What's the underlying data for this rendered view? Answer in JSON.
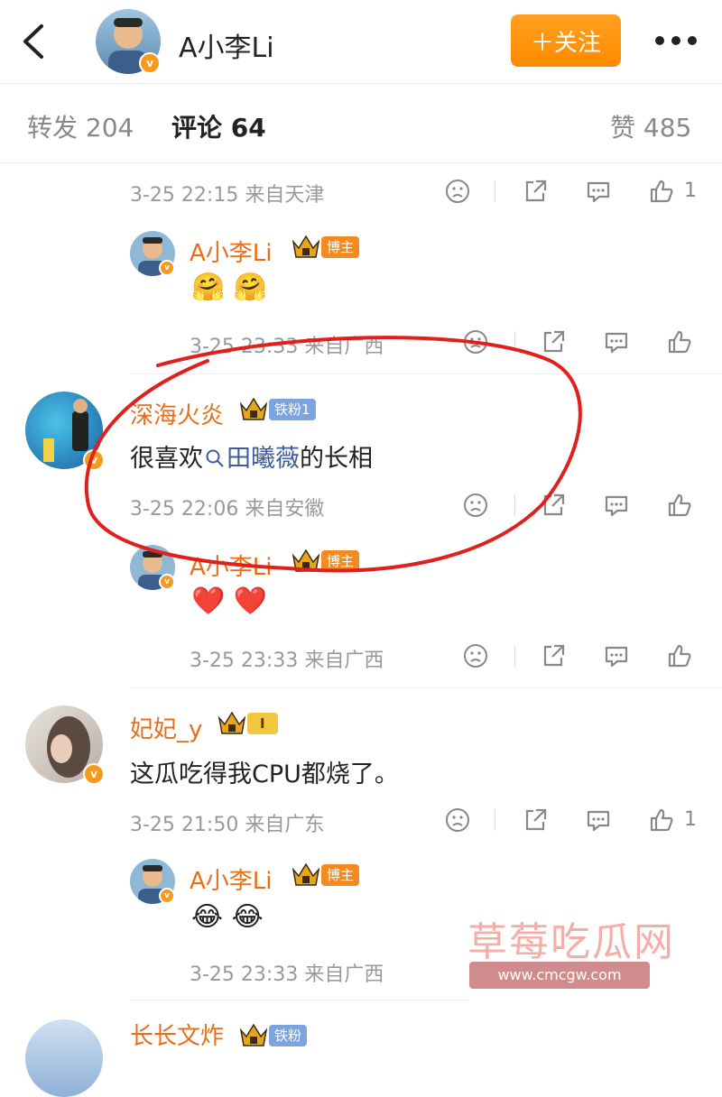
{
  "header": {
    "back_icon": "back-arrow-icon",
    "name": "A小李Li",
    "follow_label": "＋关注",
    "more_icon": "more-dots-icon",
    "accent_color": "#ff8a00"
  },
  "tabs": {
    "repost": "转发 204",
    "comments": "评论 64",
    "likes": "赞 485"
  },
  "comments": [
    {
      "meta": "3-25 22:15 来自天津",
      "like_count": "1"
    },
    {
      "author": "A小李Li",
      "badge": "博主",
      "text": "🤗 🤗",
      "meta": "3-25 23:33 来自广西"
    },
    {
      "author": "深海火炎",
      "badge": "铁粉1",
      "text_prefix": "很喜欢",
      "text_link": "田曦薇",
      "text_suffix": "的长相",
      "meta": "3-25 22:06 来自安徽"
    },
    {
      "author": "A小李Li",
      "badge": "博主",
      "text": "❤️ ❤️",
      "meta": "3-25 23:33 来自广西"
    },
    {
      "author": "妃妃_y",
      "badge": "I",
      "text": "这瓜吃得我CPU都烧了。",
      "meta": "3-25 21:50 来自广东",
      "like_count": "1"
    },
    {
      "author": "A小李Li",
      "badge": "博主",
      "text": "😂 😂",
      "meta": "3-25 23:33 来自广西"
    },
    {
      "author": "长长文炸",
      "badge": "铁粉"
    }
  ],
  "watermark": {
    "title": "草莓吃瓜网",
    "url": "www.cmcgw.com"
  }
}
